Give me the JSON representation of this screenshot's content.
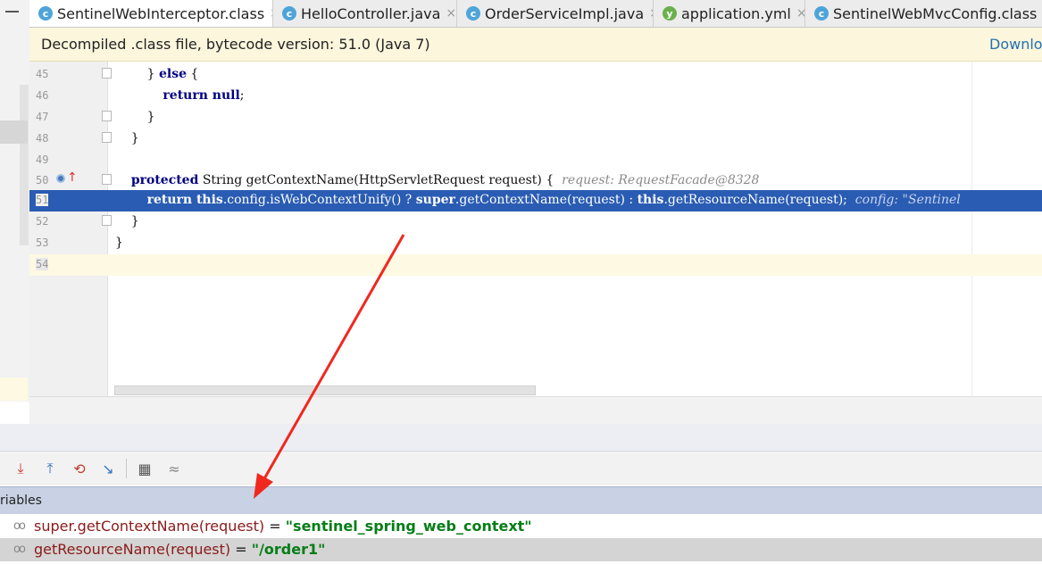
{
  "tabs": [
    {
      "label": "SentinelWebInterceptor.class",
      "icon": "class-icon",
      "active": true
    },
    {
      "label": "HelloController.java",
      "icon": "class-icon",
      "active": false
    },
    {
      "label": "OrderServiceImpl.java",
      "icon": "class-icon",
      "active": false
    },
    {
      "label": "application.yml",
      "icon": "yml-icon",
      "active": false
    },
    {
      "label": "SentinelWebMvcConfig.class",
      "icon": "class-icon",
      "active": false
    }
  ],
  "tab_close_glyph": "×",
  "banner": {
    "text": "Decompiled .class file, bytecode version: 51.0 (Java 7)",
    "link": "Download"
  },
  "editor": {
    "lines": [
      {
        "num": "45",
        "code": "        } else {"
      },
      {
        "num": "46",
        "code": "            return null;"
      },
      {
        "num": "47",
        "code": "        }"
      },
      {
        "num": "48",
        "code": "    }"
      },
      {
        "num": "49",
        "code": ""
      },
      {
        "num": "50",
        "code": "    protected String getContextName(HttpServletRequest request) {",
        "hint": "request: RequestFacade@8328"
      },
      {
        "num": "51",
        "code": "        return this.config.isWebContextUnify() ? super.getContextName(request) : this.getResourceName(request);",
        "hint": "config: \"Sentinel"
      },
      {
        "num": "52",
        "code": "    }"
      },
      {
        "num": "53",
        "code": "}"
      },
      {
        "num": "54",
        "code": ""
      }
    ]
  },
  "debug": {
    "variables_title": "riables",
    "variables": [
      {
        "name": "super.getContextName(request)",
        "eq": " = ",
        "value": "\"sentinel_spring_web_context\""
      },
      {
        "name": "getResourceName(request)",
        "eq": " = ",
        "value": "\"/order1\""
      }
    ]
  },
  "colors": {
    "highlight_line": "#2a5cb3",
    "keyword": "#000080",
    "string_value": "#067d17",
    "annotation_arrow": "#f0281e"
  }
}
